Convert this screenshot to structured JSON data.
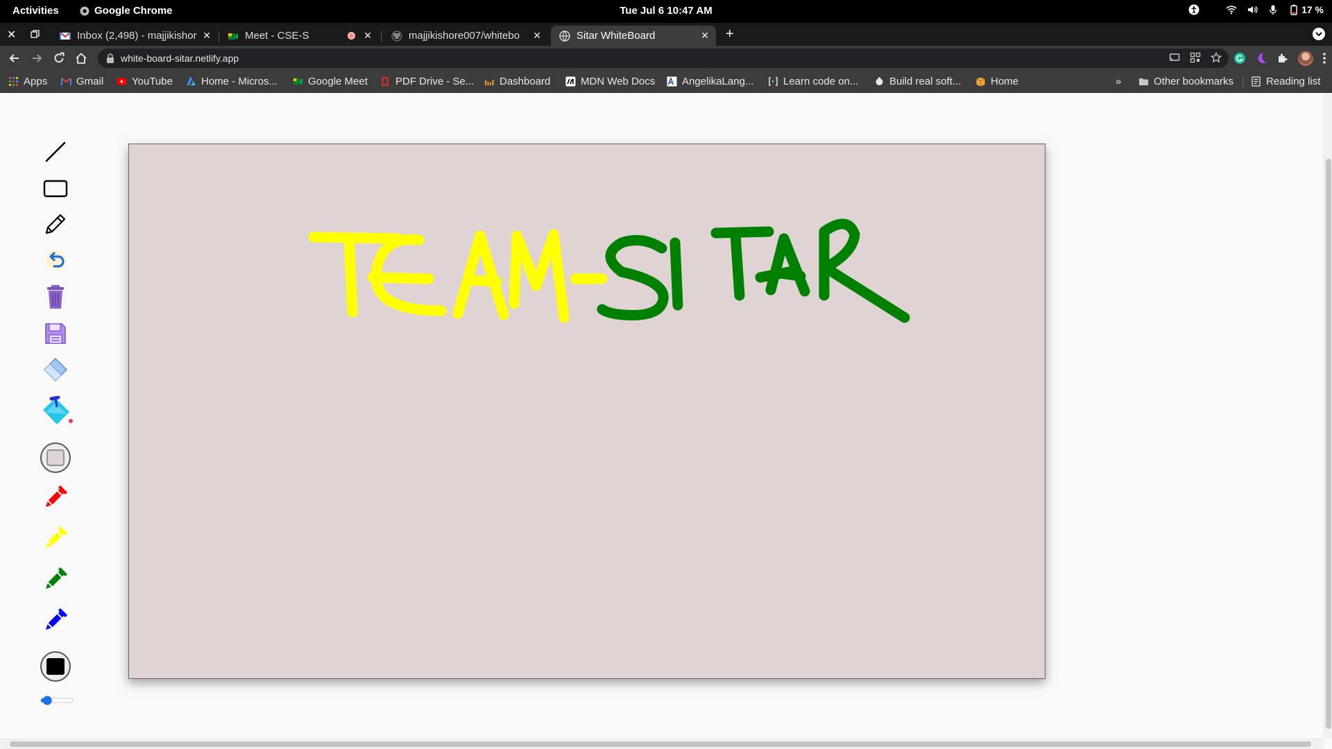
{
  "system_bar": {
    "activities": "Activities",
    "app_name": "Google Chrome",
    "clock": "Tue Jul 6  10:47 AM",
    "battery": "17 %"
  },
  "tabs": [
    {
      "title": "Inbox (2,498) - majjikishor",
      "favicon": "gmail-icon",
      "active": false
    },
    {
      "title": "Meet - CSE-S",
      "favicon": "meet-icon",
      "active": false,
      "recording": true
    },
    {
      "title": "majjikishore007/whitebo",
      "favicon": "github-icon",
      "active": false
    },
    {
      "title": "Sitar WhiteBoard",
      "favicon": "globe-icon",
      "active": true
    }
  ],
  "address_bar": {
    "url": "white-board-sitar.netlify.app"
  },
  "bookmarks": [
    {
      "label": "Apps",
      "icon": "apps-grid-icon"
    },
    {
      "label": "Gmail",
      "icon": "gmail-icon"
    },
    {
      "label": "YouTube",
      "icon": "youtube-icon"
    },
    {
      "label": "Home - Micros...",
      "icon": "azure-icon"
    },
    {
      "label": "Google Meet",
      "icon": "meet-icon"
    },
    {
      "label": "PDF Drive - Se...",
      "icon": "pdf-drive-icon"
    },
    {
      "label": "Dashboard",
      "icon": "dashboard-icon"
    },
    {
      "label": "MDN Web Docs",
      "icon": "mdn-icon"
    },
    {
      "label": "AngelikaLang...",
      "icon": "angelika-icon"
    },
    {
      "label": "Learn code on...",
      "icon": "code-icon"
    },
    {
      "label": "Build real soft...",
      "icon": "build-icon"
    },
    {
      "label": "Home",
      "icon": "box-icon"
    }
  ],
  "bookmarks_right": {
    "overflow": "»",
    "other": "Other bookmarks",
    "reading_list": "Reading list"
  },
  "whiteboard": {
    "canvas_color": "#dfd3d3",
    "drawing": [
      {
        "text": "TEAM-",
        "color": "#ffff00"
      },
      {
        "text": "SITAR",
        "color": "#008000"
      }
    ],
    "stroke_width_level": 0.2
  },
  "colors": {
    "pen_red": "#ff0000",
    "pen_yellow": "#ffff00",
    "pen_green": "#008000",
    "pen_blue": "#0000ff",
    "black": "#000000"
  }
}
